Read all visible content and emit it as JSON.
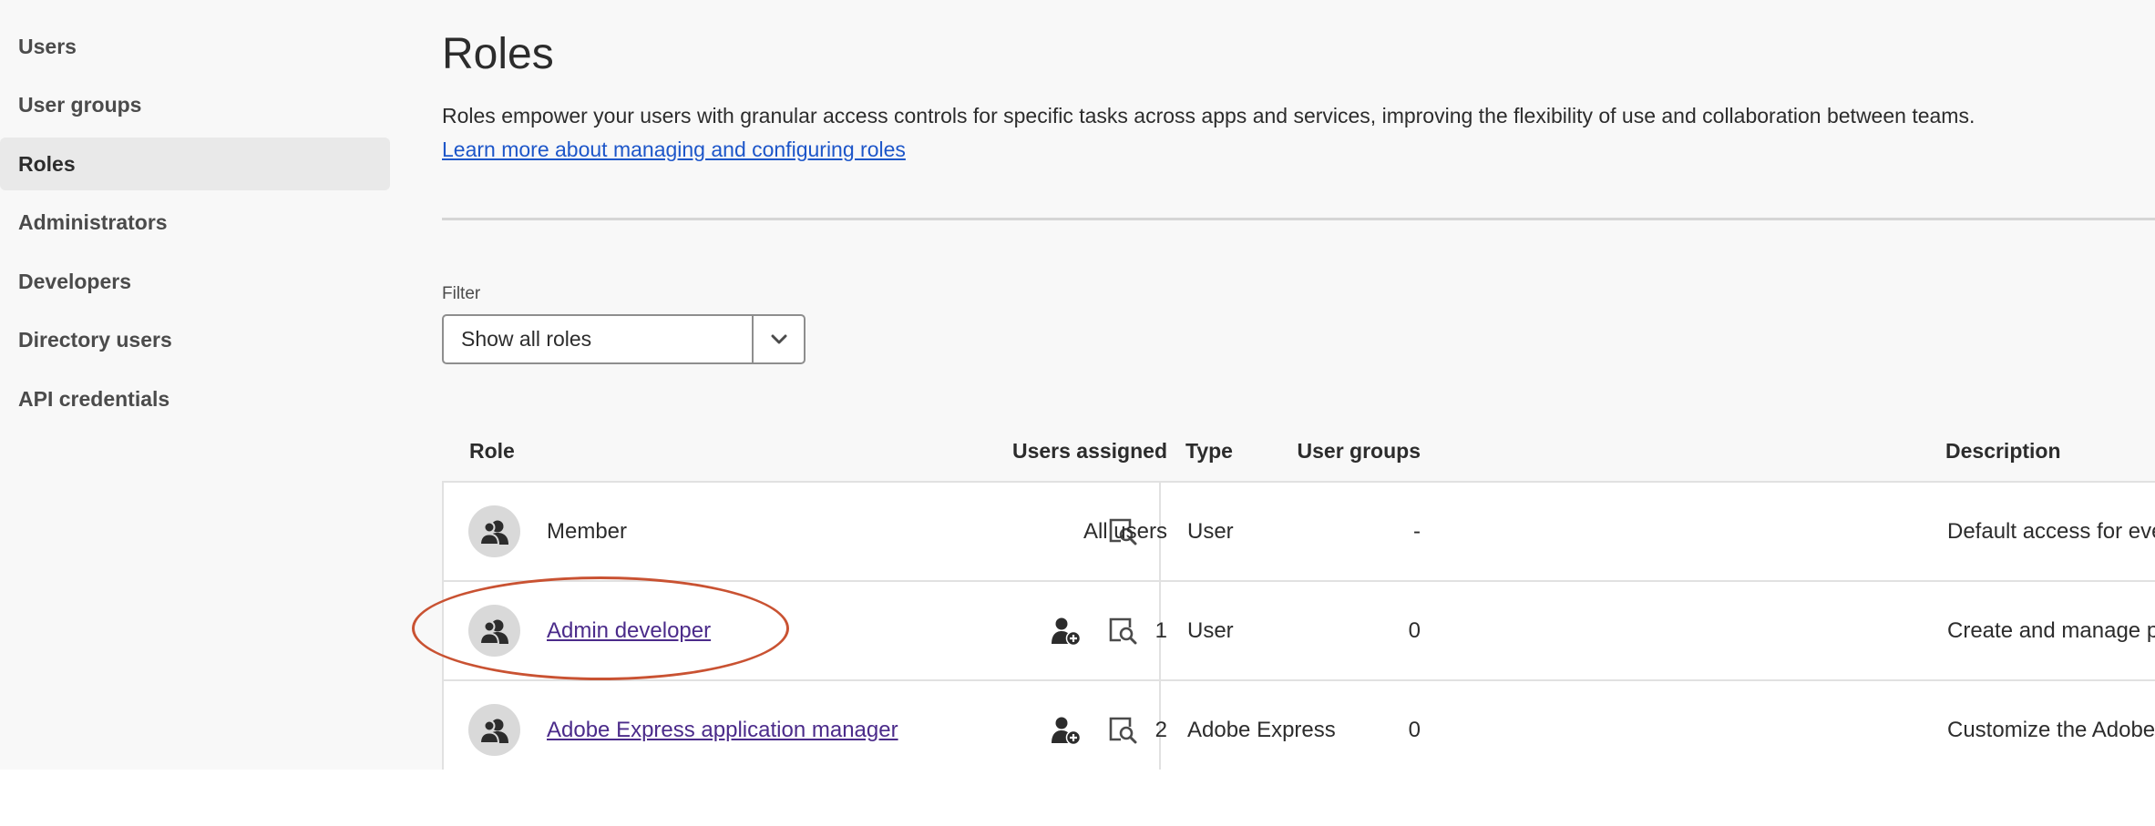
{
  "sidebar": {
    "items": [
      {
        "label": "Users",
        "active": false
      },
      {
        "label": "User groups",
        "active": false
      },
      {
        "label": "Roles",
        "active": true
      },
      {
        "label": "Administrators",
        "active": false
      },
      {
        "label": "Developers",
        "active": false
      },
      {
        "label": "Directory users",
        "active": false
      },
      {
        "label": "API credentials",
        "active": false
      }
    ]
  },
  "page": {
    "title": "Roles",
    "description": "Roles empower your users with granular access controls for specific tasks across apps and services, improving the flexibility of use and collaboration between teams.",
    "learn_more_link": "Learn more about managing and configuring roles"
  },
  "filter": {
    "label": "Filter",
    "selected": "Show all roles"
  },
  "table": {
    "columns": {
      "role": "Role",
      "type": "Type",
      "users_assigned": "Users assigned",
      "user_groups": "User groups",
      "description": "Description"
    },
    "rows": [
      {
        "role": "Member",
        "is_link": false,
        "has_add_user": false,
        "type": "User",
        "users_assigned": "All users",
        "user_groups": "-",
        "description": "Default access for ever"
      },
      {
        "role": "Admin developer",
        "is_link": true,
        "has_add_user": true,
        "type": "User",
        "users_assigned": "1",
        "user_groups": "0",
        "description": "Create and manage pr"
      },
      {
        "role": "Adobe Express application manager",
        "is_link": true,
        "has_add_user": true,
        "type": "Adobe Express",
        "users_assigned": "2",
        "user_groups": "0",
        "description": "Customize the Adobe E"
      }
    ]
  },
  "colors": {
    "link": "#1d56c9",
    "visited_link": "#4b2b8a",
    "annotation": "#c95232",
    "sidebar_active_bg": "#e9e9e9"
  },
  "icons": {
    "avatar": "user-group-icon",
    "view": "view-details-icon",
    "add_user": "add-user-icon",
    "dropdown": "chevron-down-icon"
  }
}
